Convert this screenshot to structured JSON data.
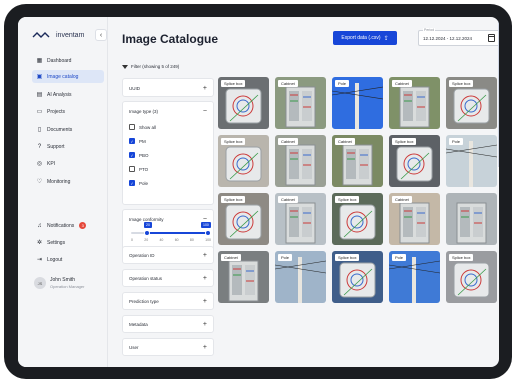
{
  "brand": {
    "logo_text": "inventam"
  },
  "sidebar": {
    "collapse_label": "‹",
    "items": [
      {
        "label": "Dashboard",
        "icon": "dashboard-icon"
      },
      {
        "label": "Image catalog",
        "icon": "image-icon",
        "active": true
      },
      {
        "label": "AI Analysis",
        "icon": "ai-icon"
      },
      {
        "label": "Projects",
        "icon": "folder-icon"
      },
      {
        "label": "Documents",
        "icon": "document-icon"
      },
      {
        "label": "Support",
        "icon": "help-icon"
      },
      {
        "label": "KPI",
        "icon": "kpi-icon"
      },
      {
        "label": "Monitoring",
        "icon": "monitoring-icon"
      }
    ],
    "bottom": [
      {
        "label": "Notifications",
        "icon": "bell-icon",
        "badge": "3"
      },
      {
        "label": "Settings",
        "icon": "gear-icon"
      },
      {
        "label": "Logout",
        "icon": "logout-icon"
      }
    ],
    "user": {
      "initials": "JS",
      "name": "John Smith",
      "role": "Operation Manager"
    }
  },
  "header": {
    "title": "Image Catalogue",
    "export_label": "Export data (.csv)",
    "period_label": "Period",
    "period_value": "12.12.2024 - 12.12.2024"
  },
  "filter": {
    "label": "Filter (showing 5 of 249)",
    "uuid_label": "UUID",
    "image_type": {
      "label": "Image type (3)",
      "options": [
        {
          "label": "Show all",
          "checked": false
        },
        {
          "label": "PM",
          "checked": true
        },
        {
          "label": "PBO",
          "checked": true
        },
        {
          "label": "PTO",
          "checked": false
        },
        {
          "label": "Pole",
          "checked": true
        }
      ]
    },
    "conformity": {
      "label": "Image conformity",
      "min": 20,
      "max": 100,
      "ticks": [
        "0",
        "20",
        "40",
        "60",
        "80",
        "100"
      ]
    },
    "collapsed": [
      "Operation ID",
      "Operation status",
      "Prediction type",
      "Metadata",
      "User"
    ]
  },
  "images": [
    {
      "label": "Splice box",
      "kind": "splice",
      "bg": "#6b6f72"
    },
    {
      "label": "Cabinet",
      "kind": "cabinet",
      "bg": "#8b9a80"
    },
    {
      "label": "Pole",
      "kind": "pole",
      "bg": "#2f6de0"
    },
    {
      "label": "Cabinet",
      "kind": "cabinet",
      "bg": "#7f9168"
    },
    {
      "label": "Splice box",
      "kind": "splice",
      "bg": "#8a8a86"
    },
    {
      "label": "Splice box",
      "kind": "splice",
      "bg": "#b9b5ad"
    },
    {
      "label": "Cabinet",
      "kind": "cabinet",
      "bg": "#9aa095"
    },
    {
      "label": "Cabinet",
      "kind": "cabinet",
      "bg": "#7b8a63"
    },
    {
      "label": "Splice box",
      "kind": "splice",
      "bg": "#5d6166"
    },
    {
      "label": "Pole",
      "kind": "pole",
      "bg": "#c7d2d9"
    },
    {
      "label": "Splice box",
      "kind": "splice",
      "bg": "#8e8a84"
    },
    {
      "label": "Cabinet",
      "kind": "cabinet",
      "bg": "#b8c0c6"
    },
    {
      "label": "Splice box",
      "kind": "splice",
      "bg": "#5c6b5a"
    },
    {
      "label": "Cabinet",
      "kind": "cabinet",
      "bg": "#c4b8a7"
    },
    {
      "label": "",
      "kind": "cabinet",
      "bg": "#aeb4b8"
    },
    {
      "label": "Cabinet",
      "kind": "cabinet",
      "bg": "#7a7e80"
    },
    {
      "label": "Pole",
      "kind": "pole",
      "bg": "#9fb4c9"
    },
    {
      "label": "Splice box",
      "kind": "splice",
      "bg": "#3f5e8a"
    },
    {
      "label": "Pole",
      "kind": "pole",
      "bg": "#3f7ad6"
    },
    {
      "label": "Splice box",
      "kind": "splice",
      "bg": "#9a9ca0"
    }
  ]
}
